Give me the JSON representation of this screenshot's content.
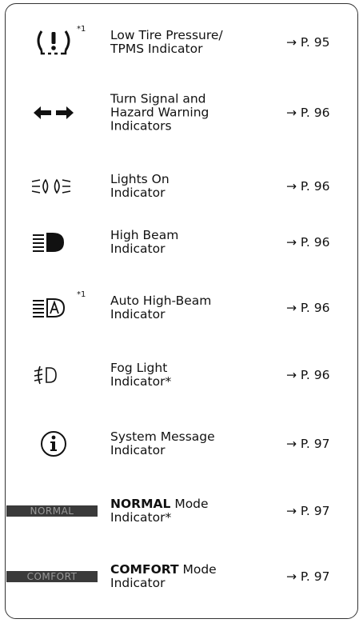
{
  "rows": [
    {
      "icon": "tire-pressure-icon",
      "footnote": "*1",
      "label_lines": [
        "Low Tire Pressure/",
        "TPMS Indicator"
      ],
      "ref": "→ P. 95"
    },
    {
      "icon": "turn-signal-arrows-icon",
      "label_lines": [
        "Turn Signal and",
        "Hazard Warning",
        "Indicators"
      ],
      "ref": "→ P. 96"
    },
    {
      "icon": "lights-on-icon",
      "label_lines": [
        "Lights On",
        "Indicator"
      ],
      "ref": "→ P. 96"
    },
    {
      "icon": "high-beam-icon",
      "label_lines": [
        "High Beam",
        "Indicator"
      ],
      "ref": "→ P. 96"
    },
    {
      "icon": "auto-high-beam-icon",
      "footnote": "*1",
      "label_lines": [
        "Auto High-Beam",
        "Indicator"
      ],
      "ref": "→ P. 96"
    },
    {
      "icon": "fog-light-icon",
      "label_lines": [
        "Fog Light",
        "Indicator*"
      ],
      "ref": "→ P. 96"
    },
    {
      "icon": "info-icon",
      "label_lines": [
        "System Message",
        "Indicator"
      ],
      "ref": "→ P. 97"
    },
    {
      "icon": "normal-mode-badge",
      "badge": "NORMAL",
      "label_bold": "NORMAL",
      "label_rest": " Mode",
      "label_line2": "Indicator*",
      "ref": "→ P. 97"
    },
    {
      "icon": "comfort-mode-badge",
      "badge": "COMFORT",
      "label_bold": "COMFORT",
      "label_rest": " Mode",
      "label_line2": "Indicator",
      "ref": "→ P. 97"
    }
  ]
}
